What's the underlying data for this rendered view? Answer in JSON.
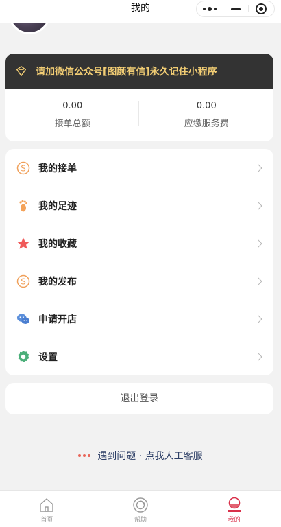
{
  "header": {
    "title": "我的"
  },
  "promo": {
    "text": "请加微信公众号[图颜有信]永久记住小程序"
  },
  "stats": [
    {
      "value": "0.00",
      "label": "接单总额"
    },
    {
      "value": "0.00",
      "label": "应缴服务费"
    }
  ],
  "menu": [
    {
      "label": "我的接单",
      "icon": "coin-s-icon"
    },
    {
      "label": "我的足迹",
      "icon": "footprint-icon"
    },
    {
      "label": "我的收藏",
      "icon": "star-icon"
    },
    {
      "label": "我的发布",
      "icon": "coin-s-icon"
    },
    {
      "label": "申请开店",
      "icon": "wechat-icon"
    },
    {
      "label": "设置",
      "icon": "gear-icon"
    }
  ],
  "logout": {
    "label": "退出登录"
  },
  "help": {
    "text": "遇到问题 · 点我人工客服"
  },
  "tabs": [
    {
      "label": "首页",
      "icon": "home-icon"
    },
    {
      "label": "帮助",
      "icon": "help-icon"
    },
    {
      "label": "我的",
      "icon": "profile-icon",
      "active": true
    }
  ],
  "colors": {
    "promo_bg": "#333333",
    "promo_text": "#f2cd74",
    "active_tab": "#d9304a",
    "help_text": "#2c3e66"
  }
}
